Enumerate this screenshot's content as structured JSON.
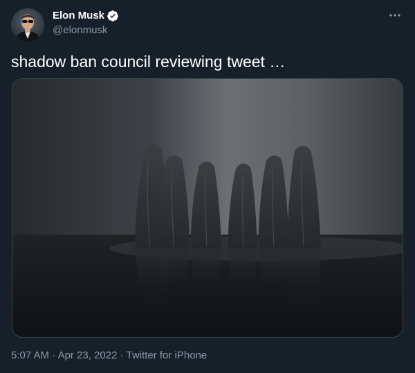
{
  "author": {
    "display_name": "Elon Musk",
    "handle": "@elonmusk",
    "verified": true,
    "verified_color": "#ffffff"
  },
  "tweet": {
    "text": "shadow ban council reviewing tweet …",
    "media_alt": "photo"
  },
  "meta": {
    "time": "5:07 AM",
    "date": "Apr 23, 2022",
    "source": "Twitter for iPhone",
    "separator": "·"
  },
  "icons": {
    "more": "more-icon",
    "verified": "verified-badge-icon"
  },
  "colors": {
    "background": "#15202b",
    "text_primary": "#ffffff",
    "text_secondary": "#8b98a5",
    "border": "#38444d"
  }
}
